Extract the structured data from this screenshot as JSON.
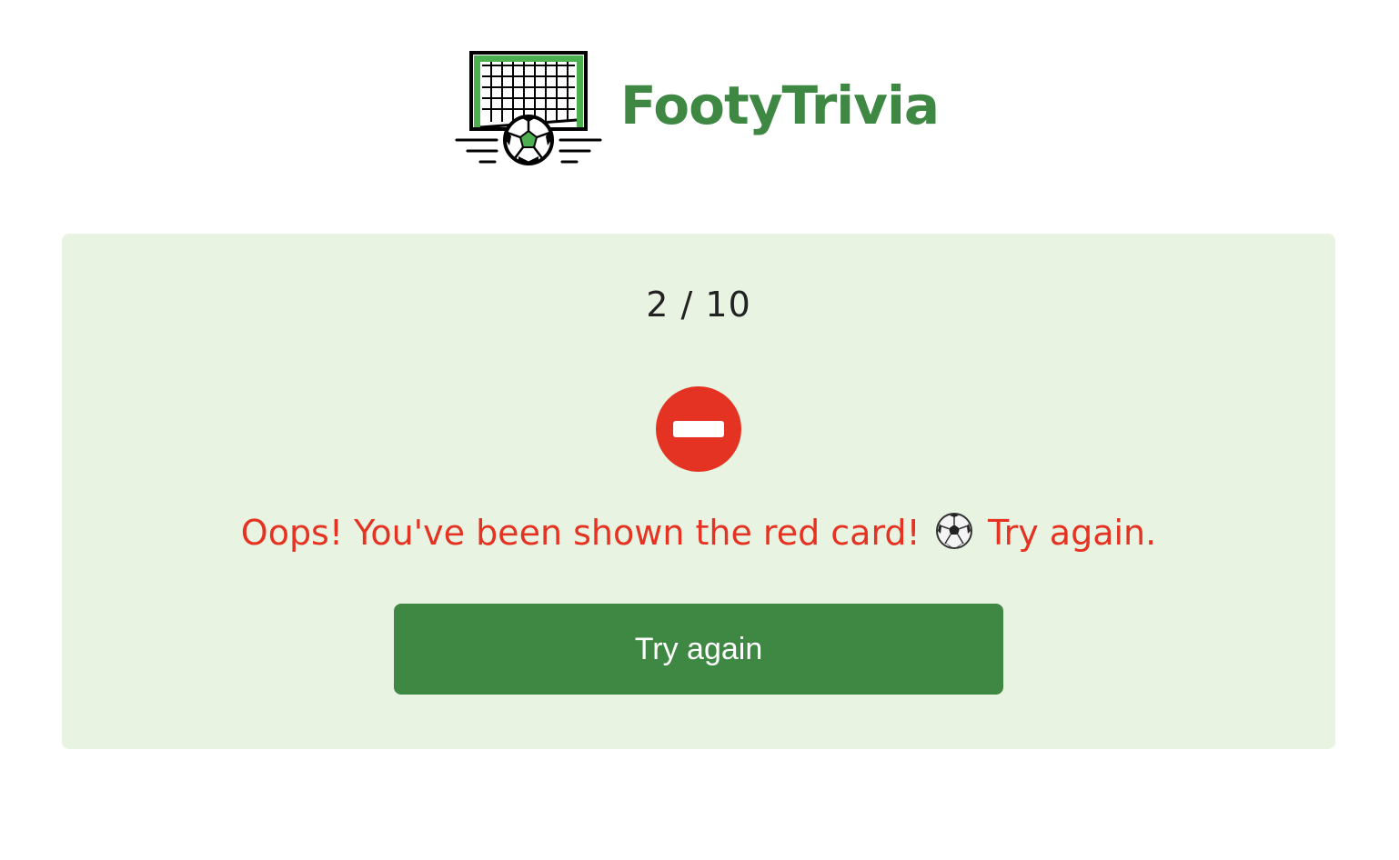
{
  "app": {
    "brand_name": "FootyTrivia",
    "logo_icon": "soccer-goal-icon"
  },
  "quiz": {
    "progress_text": "2 / 10",
    "result_icon": "no-entry-icon",
    "message_before": "Oops! You've been shown the red card!",
    "message_icon": "soccer-ball-icon",
    "message_after": "Try again.",
    "retry_button_label": "Try again"
  },
  "colors": {
    "brand_green": "#3f8844",
    "card_background": "#e8f4e1",
    "error_red": "#e53323"
  }
}
